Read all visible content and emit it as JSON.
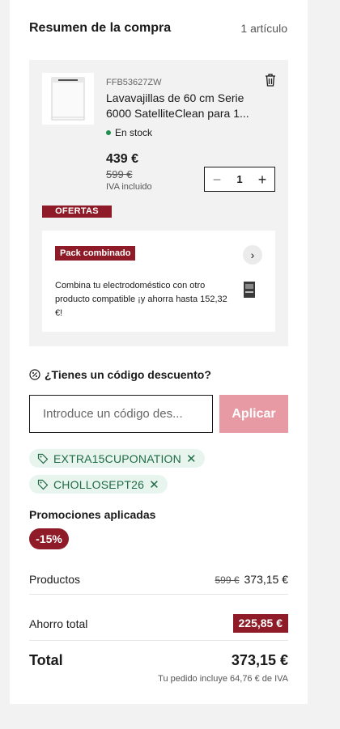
{
  "summary": {
    "title": "Resumen de la compra",
    "item_count": "1 artículo"
  },
  "product": {
    "sku": "FFB53627ZW",
    "name": "Lavavajillas de 60 cm Serie 6000 SatelliteClean para 1...",
    "stock": "En stock",
    "price": "439 €",
    "old_price": "599 €",
    "tax_note": "IVA incluido",
    "quantity": "1",
    "decrement_label": "−",
    "increment_label": "+",
    "image_icon": "dishwasher-image",
    "remove_icon": "trash-icon"
  },
  "offers": {
    "label": "OFERTAS",
    "pack_badge": "Pack combinado",
    "pack_text": "Combina tu electrodoméstico con otro producto compatible ¡y ahorra hasta 152,32 €!",
    "pack_arrow": "›"
  },
  "discount": {
    "title": "¿Tienes un código descuento?",
    "placeholder": "Introduce un código des...",
    "apply_label": "Aplicar",
    "coupons": [
      {
        "code": "EXTRA15CUPONATION",
        "remove": "✕"
      },
      {
        "code": "CHOLLOSEPT26",
        "remove": "✕"
      }
    ]
  },
  "promotions": {
    "title": "Promociones aplicadas",
    "badge": "-15%"
  },
  "totals": {
    "products_label": "Productos",
    "products_old": "599 €",
    "products_value": "373,15 €",
    "savings_label": "Ahorro total",
    "savings_value": "225,85 €",
    "total_label": "Total",
    "total_value": "373,15 €",
    "tax_note": "Tu pedido incluye 64,76 € de IVA"
  },
  "colors": {
    "accent": "#8e1b27",
    "apply_button": "#e79aa3",
    "coupon_bg": "#e8f5ee",
    "coupon_text": "#1f6b46",
    "stock_dot": "#1e8f4e"
  }
}
